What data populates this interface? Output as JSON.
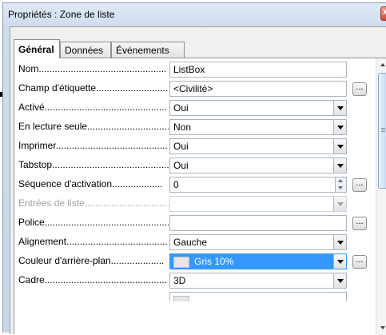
{
  "window": {
    "title": "Propriétés : Zone de liste",
    "close_label": "x"
  },
  "tabs": [
    {
      "label": "Général",
      "active": true
    },
    {
      "label": "Données",
      "active": false
    },
    {
      "label": "Événements",
      "active": false
    }
  ],
  "rows": [
    {
      "label": "Nom................................................",
      "value": "ListBox",
      "control": "text"
    },
    {
      "label": "Champ d'étiquette...........................",
      "value": "<Civilité>",
      "control": "text",
      "button": "..."
    },
    {
      "label": "Activé..............................................",
      "value": "Oui",
      "control": "dropdown"
    },
    {
      "label": "En lecture seule................................",
      "value": "Non",
      "control": "dropdown"
    },
    {
      "label": "Imprimer..........................................",
      "value": "Oui",
      "control": "dropdown"
    },
    {
      "label": "Tabstop............................................",
      "value": "Oui",
      "control": "dropdown"
    },
    {
      "label": "Séquence d'activation...................",
      "value": "0",
      "control": "spin",
      "button": "..."
    },
    {
      "label": "Entrées de liste................................",
      "value": "",
      "control": "dropdown",
      "disabled": true
    },
    {
      "label": "Police.................................................",
      "value": "",
      "control": "text",
      "button": "..."
    },
    {
      "label": "Alignement.......................................",
      "value": "Gauche",
      "control": "dropdown"
    },
    {
      "label": "Couleur d'arrière-plan....................",
      "value": "Gris 10%",
      "control": "color-dropdown",
      "button": "...",
      "selected": true
    },
    {
      "label": "Cadre..............................................",
      "value": "3D",
      "control": "dropdown"
    }
  ],
  "colors": {
    "selection": "#3399ff",
    "swatch_gris_10": "#e6e6e6",
    "pointer_arrow": "#000000"
  },
  "icons": {
    "pointer": "arrow-right-icon",
    "close": "close-icon",
    "scroll_up": "chevron-up-icon",
    "scroll_down": "chevron-down-icon"
  }
}
